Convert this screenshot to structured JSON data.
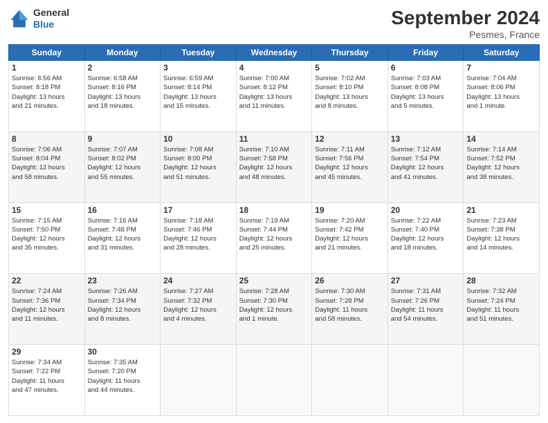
{
  "header": {
    "logo_line1": "General",
    "logo_line2": "Blue",
    "month": "September 2024",
    "location": "Pesmes, France"
  },
  "weekdays": [
    "Sunday",
    "Monday",
    "Tuesday",
    "Wednesday",
    "Thursday",
    "Friday",
    "Saturday"
  ],
  "rows": [
    [
      {
        "day": "1",
        "lines": [
          "Sunrise: 6:56 AM",
          "Sunset: 8:18 PM",
          "Daylight: 13 hours",
          "and 21 minutes."
        ]
      },
      {
        "day": "2",
        "lines": [
          "Sunrise: 6:58 AM",
          "Sunset: 8:16 PM",
          "Daylight: 13 hours",
          "and 18 minutes."
        ]
      },
      {
        "day": "3",
        "lines": [
          "Sunrise: 6:59 AM",
          "Sunset: 8:14 PM",
          "Daylight: 13 hours",
          "and 15 minutes."
        ]
      },
      {
        "day": "4",
        "lines": [
          "Sunrise: 7:00 AM",
          "Sunset: 8:12 PM",
          "Daylight: 13 hours",
          "and 11 minutes."
        ]
      },
      {
        "day": "5",
        "lines": [
          "Sunrise: 7:02 AM",
          "Sunset: 8:10 PM",
          "Daylight: 13 hours",
          "and 8 minutes."
        ]
      },
      {
        "day": "6",
        "lines": [
          "Sunrise: 7:03 AM",
          "Sunset: 8:08 PM",
          "Daylight: 13 hours",
          "and 5 minutes."
        ]
      },
      {
        "day": "7",
        "lines": [
          "Sunrise: 7:04 AM",
          "Sunset: 8:06 PM",
          "Daylight: 13 hours",
          "and 1 minute."
        ]
      }
    ],
    [
      {
        "day": "8",
        "lines": [
          "Sunrise: 7:06 AM",
          "Sunset: 8:04 PM",
          "Daylight: 12 hours",
          "and 58 minutes."
        ]
      },
      {
        "day": "9",
        "lines": [
          "Sunrise: 7:07 AM",
          "Sunset: 8:02 PM",
          "Daylight: 12 hours",
          "and 55 minutes."
        ]
      },
      {
        "day": "10",
        "lines": [
          "Sunrise: 7:08 AM",
          "Sunset: 8:00 PM",
          "Daylight: 12 hours",
          "and 51 minutes."
        ]
      },
      {
        "day": "11",
        "lines": [
          "Sunrise: 7:10 AM",
          "Sunset: 7:58 PM",
          "Daylight: 12 hours",
          "and 48 minutes."
        ]
      },
      {
        "day": "12",
        "lines": [
          "Sunrise: 7:11 AM",
          "Sunset: 7:56 PM",
          "Daylight: 12 hours",
          "and 45 minutes."
        ]
      },
      {
        "day": "13",
        "lines": [
          "Sunrise: 7:12 AM",
          "Sunset: 7:54 PM",
          "Daylight: 12 hours",
          "and 41 minutes."
        ]
      },
      {
        "day": "14",
        "lines": [
          "Sunrise: 7:14 AM",
          "Sunset: 7:52 PM",
          "Daylight: 12 hours",
          "and 38 minutes."
        ]
      }
    ],
    [
      {
        "day": "15",
        "lines": [
          "Sunrise: 7:15 AM",
          "Sunset: 7:50 PM",
          "Daylight: 12 hours",
          "and 35 minutes."
        ]
      },
      {
        "day": "16",
        "lines": [
          "Sunrise: 7:16 AM",
          "Sunset: 7:48 PM",
          "Daylight: 12 hours",
          "and 31 minutes."
        ]
      },
      {
        "day": "17",
        "lines": [
          "Sunrise: 7:18 AM",
          "Sunset: 7:46 PM",
          "Daylight: 12 hours",
          "and 28 minutes."
        ]
      },
      {
        "day": "18",
        "lines": [
          "Sunrise: 7:19 AM",
          "Sunset: 7:44 PM",
          "Daylight: 12 hours",
          "and 25 minutes."
        ]
      },
      {
        "day": "19",
        "lines": [
          "Sunrise: 7:20 AM",
          "Sunset: 7:42 PM",
          "Daylight: 12 hours",
          "and 21 minutes."
        ]
      },
      {
        "day": "20",
        "lines": [
          "Sunrise: 7:22 AM",
          "Sunset: 7:40 PM",
          "Daylight: 12 hours",
          "and 18 minutes."
        ]
      },
      {
        "day": "21",
        "lines": [
          "Sunrise: 7:23 AM",
          "Sunset: 7:38 PM",
          "Daylight: 12 hours",
          "and 14 minutes."
        ]
      }
    ],
    [
      {
        "day": "22",
        "lines": [
          "Sunrise: 7:24 AM",
          "Sunset: 7:36 PM",
          "Daylight: 12 hours",
          "and 11 minutes."
        ]
      },
      {
        "day": "23",
        "lines": [
          "Sunrise: 7:26 AM",
          "Sunset: 7:34 PM",
          "Daylight: 12 hours",
          "and 8 minutes."
        ]
      },
      {
        "day": "24",
        "lines": [
          "Sunrise: 7:27 AM",
          "Sunset: 7:32 PM",
          "Daylight: 12 hours",
          "and 4 minutes."
        ]
      },
      {
        "day": "25",
        "lines": [
          "Sunrise: 7:28 AM",
          "Sunset: 7:30 PM",
          "Daylight: 12 hours",
          "and 1 minute."
        ]
      },
      {
        "day": "26",
        "lines": [
          "Sunrise: 7:30 AM",
          "Sunset: 7:28 PM",
          "Daylight: 11 hours",
          "and 58 minutes."
        ]
      },
      {
        "day": "27",
        "lines": [
          "Sunrise: 7:31 AM",
          "Sunset: 7:26 PM",
          "Daylight: 11 hours",
          "and 54 minutes."
        ]
      },
      {
        "day": "28",
        "lines": [
          "Sunrise: 7:32 AM",
          "Sunset: 7:24 PM",
          "Daylight: 11 hours",
          "and 51 minutes."
        ]
      }
    ],
    [
      {
        "day": "29",
        "lines": [
          "Sunrise: 7:34 AM",
          "Sunset: 7:22 PM",
          "Daylight: 11 hours",
          "and 47 minutes."
        ]
      },
      {
        "day": "30",
        "lines": [
          "Sunrise: 7:35 AM",
          "Sunset: 7:20 PM",
          "Daylight: 11 hours",
          "and 44 minutes."
        ]
      },
      null,
      null,
      null,
      null,
      null
    ]
  ]
}
